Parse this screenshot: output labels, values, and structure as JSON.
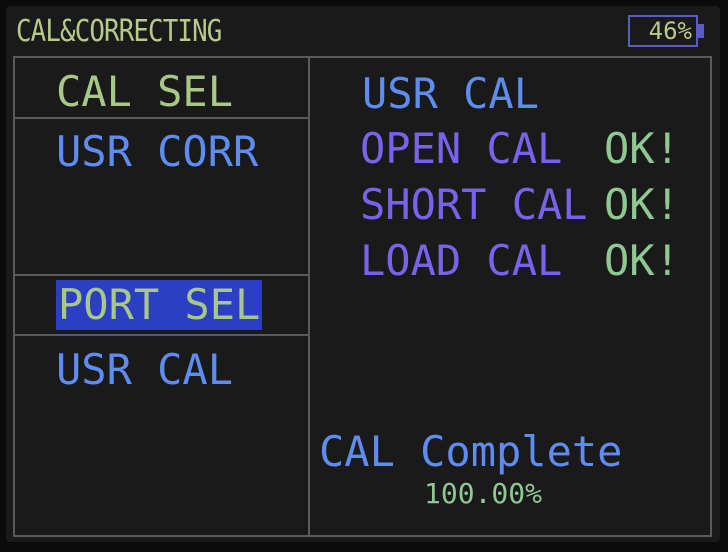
{
  "header": {
    "title": "CAL&CORRECTING",
    "battery_level": "46%"
  },
  "left_panel": {
    "cal_sel_label": "CAL SEL",
    "cal_sel_value": "USR CORR",
    "port_sel_label": "PORT SEL",
    "port_sel_value": "USR CAL"
  },
  "right_panel": {
    "heading": "USR CAL",
    "steps": [
      {
        "label": "OPEN CAL",
        "status": "OK!"
      },
      {
        "label": "SHORT CAL",
        "status": "OK!"
      },
      {
        "label": "LOAD CAL",
        "status": "OK!"
      }
    ],
    "complete_label": "CAL Complete",
    "complete_percent": "100.00%"
  },
  "colors": {
    "label_green": "#a8c888",
    "value_blue": "#5e8cf0",
    "step_violet": "#7a62ec",
    "status_green": "#8fc890",
    "highlight": "#2c3ec2",
    "background": "#1a1a1a",
    "border": "#5a5a5a"
  },
  "icons": {
    "battery": "battery-icon"
  }
}
